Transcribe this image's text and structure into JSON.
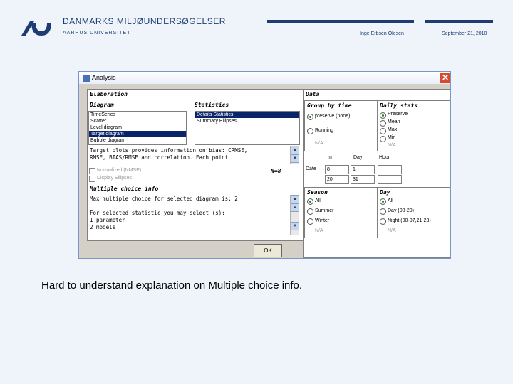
{
  "header": {
    "org_name": "DANMARKS MILJØUNDERSØGELSER",
    "university": "AARHUS UNIVERSITET",
    "author": "Inge Erbsen Olesen",
    "date": "September 21, 2010"
  },
  "window": {
    "title": "Analysis",
    "close_glyph": "✕"
  },
  "elaboration": {
    "title": "Elaboration",
    "diagram_label": "Diagram",
    "statistics_label": "Statistics",
    "diagram_items": [
      "TimeSeries",
      "Scatter",
      "Level diagram",
      "Target diagram",
      "Bubble diagram"
    ],
    "statistics_items": [
      "Details Statistics",
      "Summary Ellipses"
    ],
    "description_line1": "Target plots provides information on bias: CRMSE,",
    "description_line2": "RMSE, BIAS/RMSE and correlation. Each point",
    "normalize_label": "Normalized (NMSE)",
    "display_label": "Display Ellipses",
    "nb_label": "N=8",
    "mci_title": "Multiple choice info",
    "mci_line1": "Max multiple choice for selected diagram is: 2",
    "mci_line2": "For selected statistic you may select (s):",
    "mci_line3": "  1 parameter",
    "mci_line4": "  2 models",
    "ok_label": "OK"
  },
  "data": {
    "title": "Data",
    "group_title": "Group by time",
    "group_options": [
      "preserve (none)",
      "Running",
      "N/A"
    ],
    "daily_title": "Daily stats",
    "daily_options": [
      "Preserve",
      "Mean",
      "Max",
      "Min",
      "N/A"
    ],
    "date_label": "Date",
    "month_label": "m",
    "day_label": "Day",
    "hour_label": "Hour",
    "month_value1": "8",
    "day_value1": "1",
    "month_value2": "20",
    "day_value2": "31",
    "season_title": "Season",
    "season_options": [
      "All",
      "Summer",
      "Winter",
      "N/A"
    ],
    "day_title": "Day",
    "day_options": [
      "All",
      "Day (08-20)",
      "Night (00-07,21-23)",
      "N/A"
    ]
  },
  "caption": "Hard to understand explanation on Multiple choice info."
}
